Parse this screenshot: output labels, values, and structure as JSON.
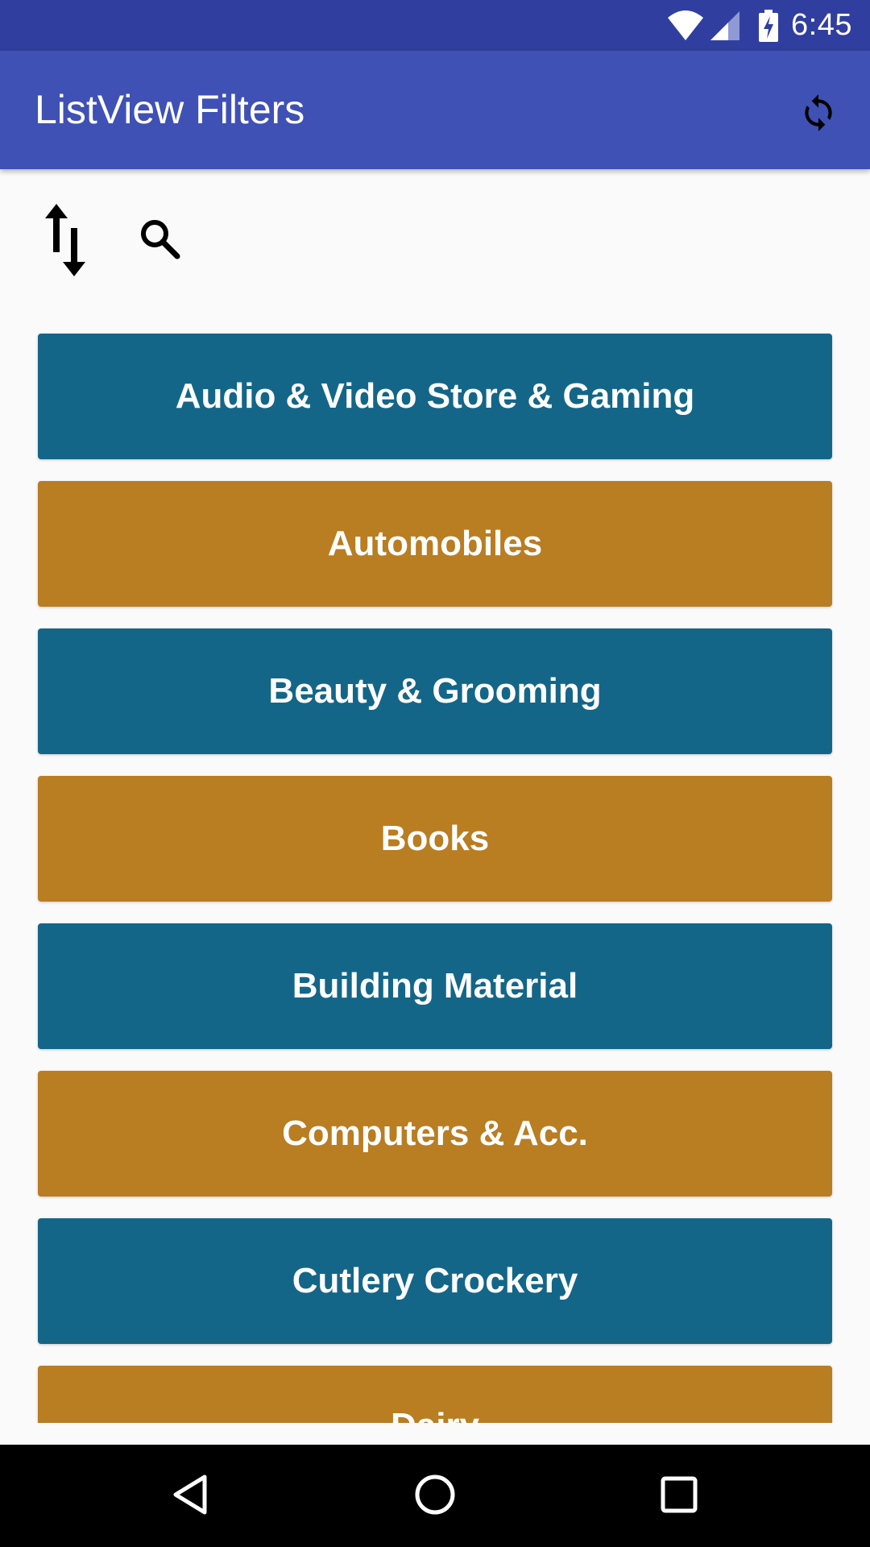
{
  "status_bar": {
    "time": "6:45",
    "icons": [
      "wifi-icon",
      "cell-signal-icon",
      "battery-charging-icon"
    ]
  },
  "app_bar": {
    "title": "ListView Filters",
    "action_icon": "refresh-icon"
  },
  "toolbar": {
    "icons": [
      "sort-icon",
      "search-icon"
    ]
  },
  "categories": [
    {
      "label": "Audio & Video Store & Gaming",
      "color": "#146688"
    },
    {
      "label": "Automobiles",
      "color": "#b97d22"
    },
    {
      "label": "Beauty & Grooming",
      "color": "#146688"
    },
    {
      "label": "Books",
      "color": "#b97d22"
    },
    {
      "label": "Building Material",
      "color": "#146688"
    },
    {
      "label": "Computers & Acc.",
      "color": "#b97d22"
    },
    {
      "label": "Cutlery Crockery",
      "color": "#146688"
    },
    {
      "label": "Dairy",
      "color": "#b97d22"
    }
  ],
  "nav_bar": {
    "icons": [
      "back-icon",
      "home-icon",
      "recents-icon"
    ]
  },
  "colors": {
    "status_bar": "#303f9f",
    "app_bar": "#3f51b5",
    "background": "#fafafa"
  }
}
